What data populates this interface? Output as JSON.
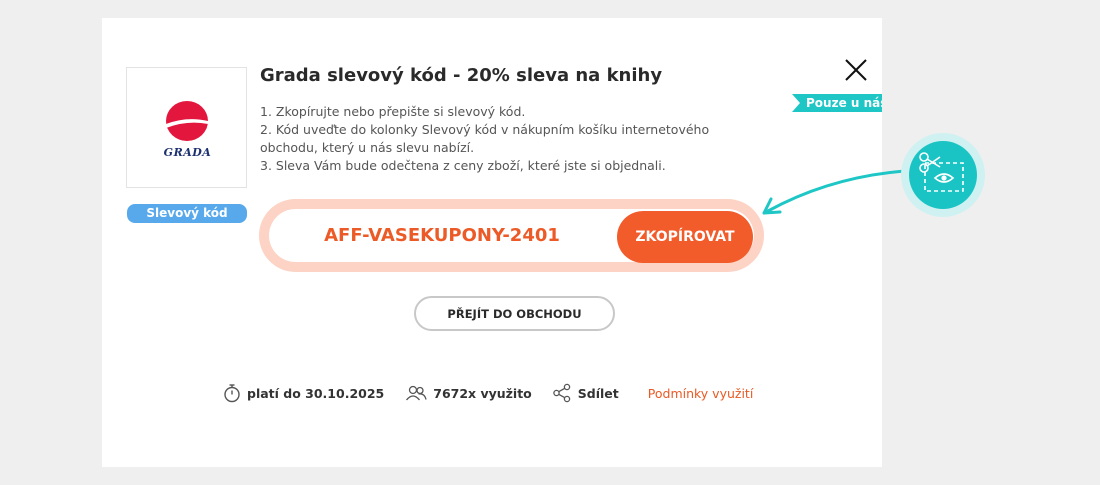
{
  "modal": {
    "title": "Grada slevový kód - 20% sleva na knihy",
    "steps": [
      "1. Zkopírujte nebo přepište si slevový kód.",
      "2. Kód uveďte do kolonky Slevový kód v nákupním košíku internetového obchodu, který u nás slevu nabízí.",
      "3. Sleva Vám bude odečtena z ceny zboží, které jste si objednali."
    ],
    "logo_text": "GRADA",
    "badge": "Slevový kód",
    "ribbon": "Pouze u nás",
    "code": "AFF-VASEKUPONY-2401",
    "copy_label": "ZKOPÍROVAT",
    "shop_label": "PŘEJÍT DO OBCHODU",
    "footer": {
      "valid": "platí do 30.10.2025",
      "used": "7672x využito",
      "share": "Sdílet",
      "terms": "Podmínky využití"
    }
  },
  "colors": {
    "accent": "#f25b2a",
    "code_text": "#ec5b27",
    "badge": "#57a9ec",
    "teal": "#1ec6c6",
    "logo_red": "#e3173e",
    "logo_navy": "#1c2f6e"
  },
  "icons": [
    "close-icon",
    "stopwatch-icon",
    "users-icon",
    "share-icon",
    "scissors-icon",
    "eye-icon",
    "arrow-icon"
  ]
}
